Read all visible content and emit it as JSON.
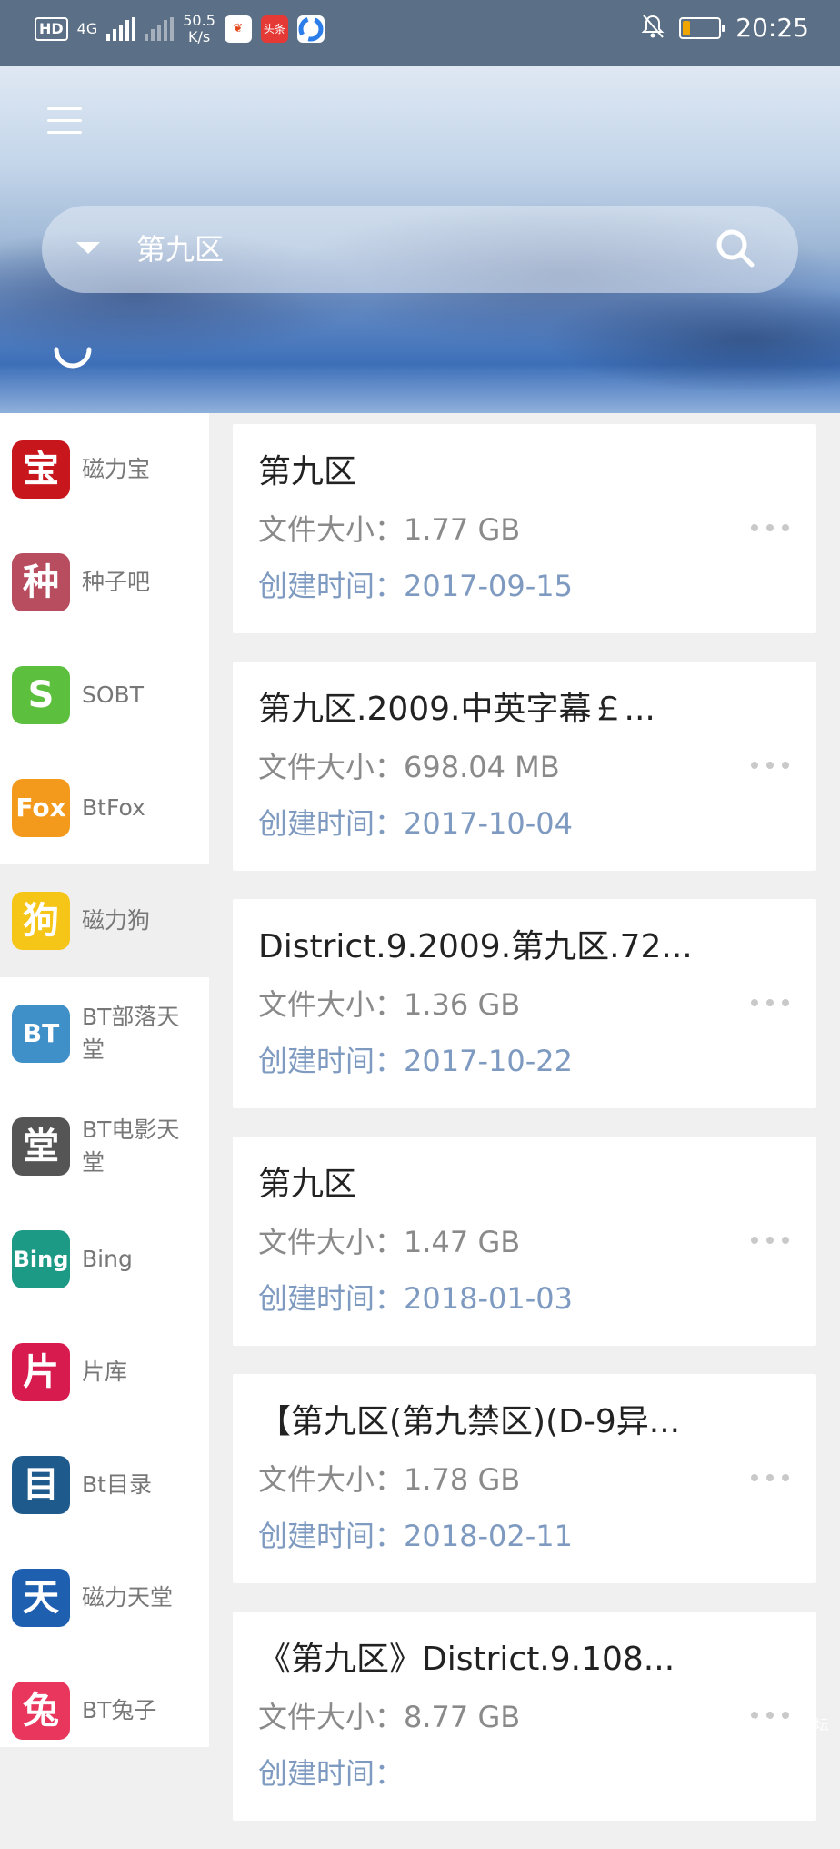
{
  "status_bar": {
    "hd": "HD",
    "net_type": "4G",
    "speed_value": "50.5",
    "speed_unit": "K/s",
    "notif_app_2": "头条",
    "time": "20:25",
    "battery_level": 0.2,
    "battery_color": "#f0a500"
  },
  "search": {
    "query": "第九区"
  },
  "sidebar": {
    "items": [
      {
        "label": "磁力宝",
        "icon_text": "宝",
        "color": "#c8161d"
      },
      {
        "label": "种子吧",
        "icon_text": "种",
        "color": "#b84d5f"
      },
      {
        "label": "SOBT",
        "icon_text": "S",
        "color": "#5cbf3d"
      },
      {
        "label": "BtFox",
        "icon_text": "Fox",
        "color": "#f39a1c"
      },
      {
        "label": "磁力狗",
        "icon_text": "狗",
        "color": "#f5c518"
      },
      {
        "label": "BT部落天堂",
        "icon_text": "BT",
        "color": "#3f8fc8"
      },
      {
        "label": "BT电影天堂",
        "icon_text": "堂",
        "color": "#555555"
      },
      {
        "label": "Bing",
        "icon_text": "Bing",
        "color": "#1d9a86"
      },
      {
        "label": "片库",
        "icon_text": "片",
        "color": "#d81b4f"
      },
      {
        "label": "Bt目录",
        "icon_text": "目",
        "color": "#1f5a8c"
      },
      {
        "label": "磁力天堂",
        "icon_text": "天",
        "color": "#1e5fb0"
      },
      {
        "label": "BT兔子",
        "icon_text": "兔",
        "color": "#e8365d"
      }
    ],
    "active_index": 4
  },
  "results": [
    {
      "title": "第九区",
      "size_label": "文件大小：",
      "size": "1.77 GB",
      "date_label": "创建时间：",
      "date": "2017-09-15"
    },
    {
      "title": "第九区.2009.中英字幕￡...",
      "size_label": "文件大小：",
      "size": "698.04 MB",
      "date_label": "创建时间：",
      "date": "2017-10-04"
    },
    {
      "title": "District.9.2009.第九区.72...",
      "size_label": "文件大小：",
      "size": "1.36 GB",
      "date_label": "创建时间：",
      "date": "2017-10-22"
    },
    {
      "title": "第九区",
      "size_label": "文件大小：",
      "size": "1.47 GB",
      "date_label": "创建时间：",
      "date": "2018-01-03"
    },
    {
      "title": "【第九区(第九禁区)(D-9异...",
      "size_label": "文件大小：",
      "size": "1.78 GB",
      "date_label": "创建时间：",
      "date": "2018-02-11"
    },
    {
      "title": "《第九区》District.9.108...",
      "size_label": "文件大小：",
      "size": "8.77 GB",
      "date_label": "创建时间：",
      "date": ""
    }
  ]
}
